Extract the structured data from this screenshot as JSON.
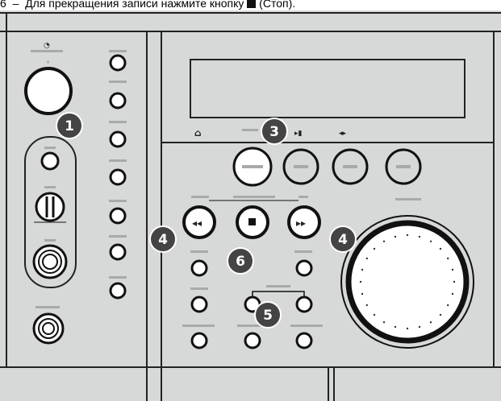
{
  "caption": {
    "prefix": "6",
    "text": "Для прекращения записи нажмите кнопку",
    "stop_word": "(Стоп)."
  },
  "callouts": {
    "power": "1",
    "button_group": "3",
    "skip": "4",
    "record_link": "5",
    "stop": "6"
  },
  "colors": {
    "panel": "#d6d9d8",
    "outline": "#222222",
    "callout": "#444444",
    "label_bar": "#a8aaa9"
  },
  "icons": {
    "timer": "clock-icon",
    "stop_glyph": "stop-square-icon",
    "skip_back": "skip-back-icon",
    "skip_forward": "skip-forward-icon"
  }
}
